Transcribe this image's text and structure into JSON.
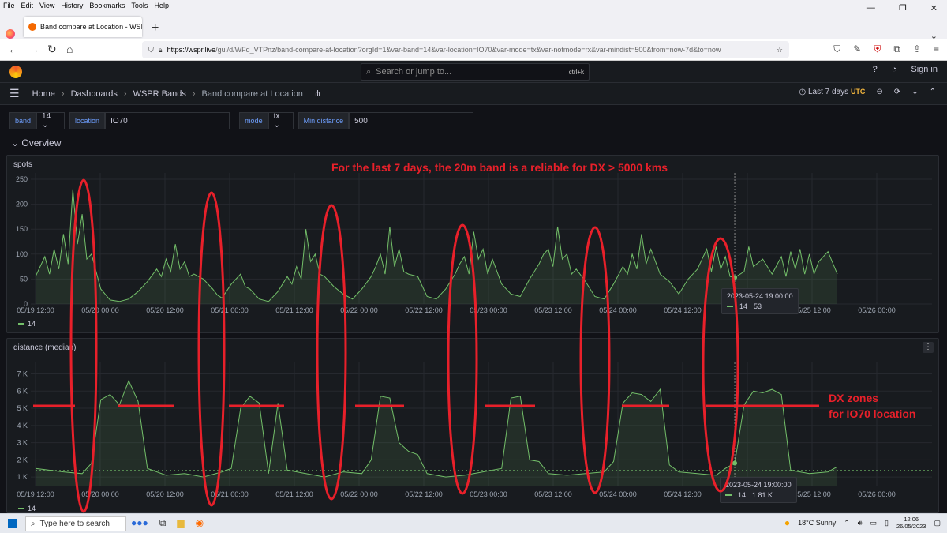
{
  "browser": {
    "menu": [
      "File",
      "Edit",
      "View",
      "History",
      "Bookmarks",
      "Tools",
      "Help"
    ],
    "tab_title": "Band compare at Location - WSPR",
    "url_domain": "https://wspr.live",
    "url_rest": "/gui/d/WFd_VTPnz/band-compare-at-location?orgId=1&var-band=14&var-location=IO70&var-mode=tx&var-notmode=rx&var-mindist=500&from=now-7d&to=now"
  },
  "grafana": {
    "search_placeholder": "Search or jump to...",
    "search_shortcut": "ctrl+k",
    "sign_in": "Sign in",
    "breadcrumb": [
      "Home",
      "Dashboards",
      "WSPR Bands",
      "Band compare at Location"
    ],
    "time_range": "Last 7 days",
    "timezone": "UTC",
    "variables": [
      {
        "label": "band",
        "value": "14 ⌄"
      },
      {
        "label": "location",
        "value": "IO70"
      },
      {
        "label": "mode",
        "value": "tx ⌄"
      },
      {
        "label": "Min distance",
        "value": "500"
      }
    ],
    "row_title": "Overview"
  },
  "panels": {
    "spots": {
      "title": "spots",
      "legend": "14",
      "tooltip_time": "2023-05-24 19:00:00",
      "tooltip_series": "14",
      "tooltip_value": "53"
    },
    "distance": {
      "title": "distance (median)",
      "legend": "14",
      "tooltip_time": "2023-05-24 19:00:00",
      "tooltip_series": "14",
      "tooltip_value": "1.81 K"
    }
  },
  "annotations": {
    "headline": "For the last 7 days, the 20m band is a reliable for DX > 5000 kms",
    "dx_line1": "DX zones",
    "dx_line2": "for IO70 location",
    "color": "#e8202a"
  },
  "taskbar": {
    "search_placeholder": "Type here to search",
    "weather": "18°C  Sunny",
    "time": "12:06",
    "date": "26/05/2023"
  },
  "chart_data": [
    {
      "type": "area",
      "title": "spots",
      "x_ticks": [
        "05/19 12:00",
        "05/20 00:00",
        "05/20 12:00",
        "05/21 00:00",
        "05/21 12:00",
        "05/22 00:00",
        "05/22 12:00",
        "05/23 00:00",
        "05/23 12:00",
        "05/24 00:00",
        "05/24 12:00",
        "05/25 00:00",
        "05/25 12:00",
        "05/26 00:00"
      ],
      "x_first_label": "05/19 12:00",
      "y_ticks": [
        "0",
        "50",
        "100",
        "150",
        "200",
        "250"
      ],
      "ylim": [
        0,
        250
      ],
      "series": [
        {
          "name": "14",
          "color": "#73bf69",
          "points": [
            [
              0,
              55
            ],
            [
              1,
              95
            ],
            [
              1.5,
              60
            ],
            [
              2,
              110
            ],
            [
              2.5,
              70
            ],
            [
              3,
              140
            ],
            [
              3.5,
              80
            ],
            [
              4,
              230
            ],
            [
              4.5,
              120
            ],
            [
              5,
              180
            ],
            [
              5.5,
              90
            ],
            [
              6,
              100
            ],
            [
              7,
              30
            ],
            [
              8,
              8
            ],
            [
              9,
              5
            ],
            [
              10,
              10
            ],
            [
              11,
              25
            ],
            [
              12,
              45
            ],
            [
              13,
              70
            ],
            [
              13.5,
              55
            ],
            [
              14,
              90
            ],
            [
              14.5,
              65
            ],
            [
              15,
              120
            ],
            [
              15.5,
              70
            ],
            [
              16,
              85
            ],
            [
              16.5,
              55
            ],
            [
              17,
              60
            ],
            [
              18,
              50
            ],
            [
              19,
              30
            ],
            [
              19.5,
              18
            ],
            [
              20,
              12
            ],
            [
              21,
              40
            ],
            [
              22,
              60
            ],
            [
              22.5,
              35
            ],
            [
              23,
              30
            ],
            [
              24,
              10
            ],
            [
              25,
              5
            ],
            [
              26,
              25
            ],
            [
              27,
              55
            ],
            [
              27.5,
              40
            ],
            [
              28,
              75
            ],
            [
              28.5,
              50
            ],
            [
              29,
              150
            ],
            [
              29.5,
              85
            ],
            [
              30,
              100
            ],
            [
              30.5,
              60
            ],
            [
              31,
              55
            ],
            [
              32,
              35
            ],
            [
              33,
              20
            ],
            [
              34,
              10
            ],
            [
              35,
              30
            ],
            [
              36,
              55
            ],
            [
              36.5,
              75
            ],
            [
              37,
              100
            ],
            [
              37.5,
              60
            ],
            [
              38,
              155
            ],
            [
              38.5,
              75
            ],
            [
              39,
              110
            ],
            [
              39.5,
              65
            ],
            [
              40,
              60
            ],
            [
              41,
              55
            ],
            [
              42,
              15
            ],
            [
              43,
              10
            ],
            [
              44,
              30
            ],
            [
              45,
              60
            ],
            [
              45.5,
              80
            ],
            [
              46,
              95
            ],
            [
              46.5,
              60
            ],
            [
              47,
              145
            ],
            [
              47.5,
              90
            ],
            [
              48,
              110
            ],
            [
              48.5,
              60
            ],
            [
              49,
              90
            ],
            [
              50,
              40
            ],
            [
              51,
              20
            ],
            [
              52,
              15
            ],
            [
              53,
              50
            ],
            [
              54,
              80
            ],
            [
              54.5,
              100
            ],
            [
              55,
              110
            ],
            [
              55.5,
              75
            ],
            [
              56,
              155
            ],
            [
              56.5,
              90
            ],
            [
              57,
              100
            ],
            [
              57.5,
              60
            ],
            [
              58,
              70
            ],
            [
              59,
              45
            ],
            [
              60,
              15
            ],
            [
              61,
              10
            ],
            [
              62,
              40
            ],
            [
              63,
              75
            ],
            [
              63.5,
              60
            ],
            [
              64,
              100
            ],
            [
              64.5,
              70
            ],
            [
              65,
              140
            ],
            [
              65.5,
              80
            ],
            [
              66,
              110
            ],
            [
              67,
              60
            ],
            [
              68,
              45
            ],
            [
              69,
              20
            ],
            [
              70,
              50
            ],
            [
              71,
              70
            ],
            [
              71.5,
              90
            ],
            [
              72,
              110
            ],
            [
              72.5,
              65
            ],
            [
              73,
              115
            ],
            [
              73.5,
              70
            ],
            [
              74,
              95
            ],
            [
              74.5,
              55
            ],
            [
              75,
              53
            ],
            [
              76,
              65
            ],
            [
              76.5,
              115
            ],
            [
              77,
              75
            ],
            [
              78,
              90
            ],
            [
              79,
              60
            ],
            [
              80,
              95
            ],
            [
              80.5,
              55
            ],
            [
              81,
              105
            ],
            [
              81.5,
              70
            ],
            [
              82,
              110
            ],
            [
              82.5,
              60
            ],
            [
              83,
              100
            ],
            [
              83.5,
              60
            ],
            [
              84,
              85
            ],
            [
              85,
              105
            ],
            [
              86,
              60
            ]
          ]
        }
      ]
    },
    {
      "type": "area",
      "title": "distance (median)",
      "x_ticks": [
        "05/19 12:00",
        "05/20 00:00",
        "05/20 12:00",
        "05/21 00:00",
        "05/21 12:00",
        "05/22 00:00",
        "05/22 12:00",
        "05/23 00:00",
        "05/23 12:00",
        "05/24 00:00",
        "05/24 12:00",
        "05/25 00:00",
        "05/25 12:00",
        "05/26 00:00"
      ],
      "y_ticks": [
        "1 K",
        "2 K",
        "3 K",
        "4 K",
        "5 K",
        "6 K",
        "7 K"
      ],
      "ylim": [
        500,
        7300
      ],
      "series": [
        {
          "name": "14",
          "color": "#73bf69",
          "points": [
            [
              0,
              1500
            ],
            [
              3,
              1300
            ],
            [
              5,
              1200
            ],
            [
              6,
              1800
            ],
            [
              7,
              5500
            ],
            [
              8,
              5800
            ],
            [
              9,
              5200
            ],
            [
              10,
              6600
            ],
            [
              11,
              5400
            ],
            [
              12,
              1500
            ],
            [
              14,
              1100
            ],
            [
              16,
              1200
            ],
            [
              18,
              1000
            ],
            [
              20,
              1300
            ],
            [
              21,
              1500
            ],
            [
              22,
              5000
            ],
            [
              23,
              5700
            ],
            [
              24,
              5300
            ],
            [
              25,
              1200
            ],
            [
              26,
              5300
            ],
            [
              27,
              1400
            ],
            [
              29,
              1200
            ],
            [
              31,
              1000
            ],
            [
              33,
              1300
            ],
            [
              35,
              1200
            ],
            [
              36,
              2000
            ],
            [
              37,
              5700
            ],
            [
              38,
              5600
            ],
            [
              39,
              3000
            ],
            [
              40,
              2500
            ],
            [
              41,
              2300
            ],
            [
              42,
              1200
            ],
            [
              44,
              1000
            ],
            [
              46,
              1100
            ],
            [
              48,
              1300
            ],
            [
              50,
              1500
            ],
            [
              51,
              5600
            ],
            [
              52,
              5700
            ],
            [
              53,
              2000
            ],
            [
              54,
              1900
            ],
            [
              55,
              1200
            ],
            [
              57,
              1100
            ],
            [
              59,
              1200
            ],
            [
              61,
              1300
            ],
            [
              62,
              1900
            ],
            [
              63,
              5300
            ],
            [
              64,
              5900
            ],
            [
              65,
              5800
            ],
            [
              66,
              5400
            ],
            [
              67,
              6100
            ],
            [
              68,
              1700
            ],
            [
              69,
              1300
            ],
            [
              71,
              1200
            ],
            [
              73,
              1100
            ],
            [
              74,
              1500
            ],
            [
              75,
              1810
            ],
            [
              76,
              5200
            ],
            [
              77,
              6000
            ],
            [
              78,
              5900
            ],
            [
              79,
              6100
            ],
            [
              80,
              5800
            ],
            [
              81,
              1400
            ],
            [
              83,
              1200
            ],
            [
              85,
              1300
            ],
            [
              86,
              1600
            ]
          ]
        }
      ]
    }
  ]
}
